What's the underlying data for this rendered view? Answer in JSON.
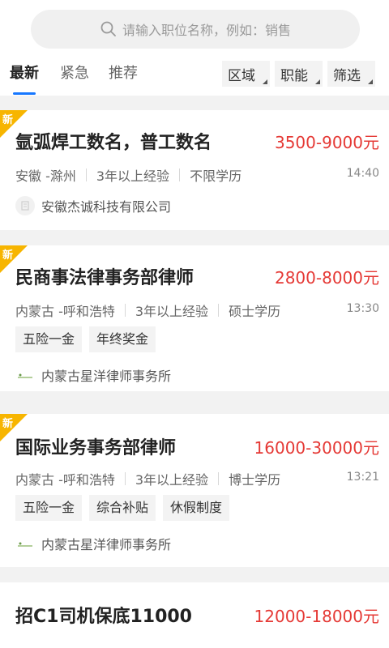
{
  "search": {
    "placeholder": "请输入职位名称，例如：销售"
  },
  "tabs": [
    {
      "label": "最新"
    },
    {
      "label": "紧急"
    },
    {
      "label": "推荐"
    }
  ],
  "filters": [
    {
      "label": "区域"
    },
    {
      "label": "职能"
    },
    {
      "label": "筛选"
    }
  ],
  "accent_color": "#1677ff",
  "salary_color": "#e53935",
  "badge_color": "#f7b500",
  "jobs": [
    {
      "badge": "新",
      "title": "氩弧焊工数名，普工数名",
      "salary": "3500-9000元",
      "location": "安徽 -滁州",
      "experience": "3年以上经验",
      "education": "不限学历",
      "time": "14:40",
      "tags": [],
      "company": "安徽杰诚科技有限公司"
    },
    {
      "badge": "新",
      "title": "民商事法律事务部律师",
      "salary": "2800-8000元",
      "location": "内蒙古 -呼和浩特",
      "experience": "3年以上经验",
      "education": "硕士学历",
      "time": "13:30",
      "tags": [
        "五险一金",
        "年终奖金"
      ],
      "company": "内蒙古星洋律师事务所"
    },
    {
      "badge": "新",
      "title": "国际业务事务部律师",
      "salary": "16000-30000元",
      "location": "内蒙古 -呼和浩特",
      "experience": "3年以上经验",
      "education": "博士学历",
      "time": "13:21",
      "tags": [
        "五险一金",
        "综合补贴",
        "休假制度"
      ],
      "company": "内蒙古星洋律师事务所"
    },
    {
      "title": "招C1司机保底11000",
      "salary": "12000-18000元"
    }
  ]
}
